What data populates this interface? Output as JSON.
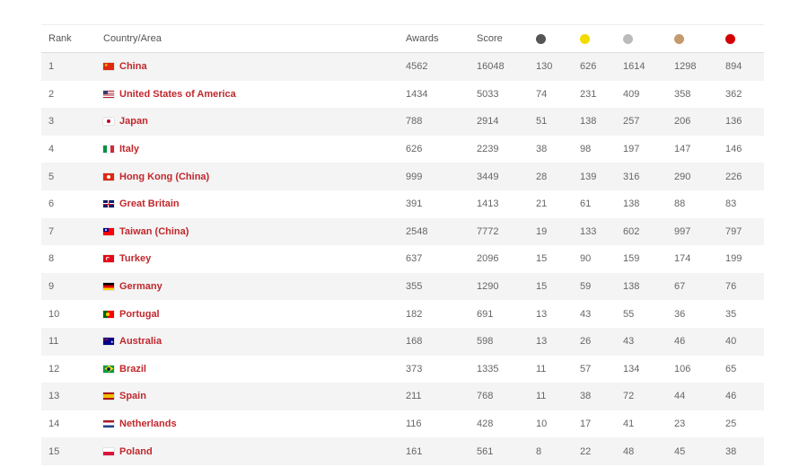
{
  "header": {
    "rank": "Rank",
    "country": "Country/Area",
    "awards": "Awards",
    "score": "Score",
    "medal_colors": [
      "#555555",
      "#f2dc00",
      "#bbbbbb",
      "#c49a6c",
      "#d40000"
    ]
  },
  "rows": [
    {
      "rank": "1",
      "country": "China",
      "flag": "china-flag-icon",
      "awards": "4562",
      "score": "16048",
      "m": [
        "130",
        "626",
        "1614",
        "1298",
        "894"
      ]
    },
    {
      "rank": "2",
      "country": "United States of America",
      "flag": "usa-flag-icon",
      "awards": "1434",
      "score": "5033",
      "m": [
        "74",
        "231",
        "409",
        "358",
        "362"
      ]
    },
    {
      "rank": "3",
      "country": "Japan",
      "flag": "japan-flag-icon",
      "awards": "788",
      "score": "2914",
      "m": [
        "51",
        "138",
        "257",
        "206",
        "136"
      ]
    },
    {
      "rank": "4",
      "country": "Italy",
      "flag": "italy-flag-icon",
      "awards": "626",
      "score": "2239",
      "m": [
        "38",
        "98",
        "197",
        "147",
        "146"
      ]
    },
    {
      "rank": "5",
      "country": "Hong Kong (China)",
      "flag": "hong-kong-flag-icon",
      "awards": "999",
      "score": "3449",
      "m": [
        "28",
        "139",
        "316",
        "290",
        "226"
      ]
    },
    {
      "rank": "6",
      "country": "Great Britain",
      "flag": "great-britain-flag-icon",
      "awards": "391",
      "score": "1413",
      "m": [
        "21",
        "61",
        "138",
        "88",
        "83"
      ]
    },
    {
      "rank": "7",
      "country": "Taiwan (China)",
      "flag": "taiwan-flag-icon",
      "awards": "2548",
      "score": "7772",
      "m": [
        "19",
        "133",
        "602",
        "997",
        "797"
      ]
    },
    {
      "rank": "8",
      "country": "Turkey",
      "flag": "turkey-flag-icon",
      "awards": "637",
      "score": "2096",
      "m": [
        "15",
        "90",
        "159",
        "174",
        "199"
      ]
    },
    {
      "rank": "9",
      "country": "Germany",
      "flag": "germany-flag-icon",
      "awards": "355",
      "score": "1290",
      "m": [
        "15",
        "59",
        "138",
        "67",
        "76"
      ]
    },
    {
      "rank": "10",
      "country": "Portugal",
      "flag": "portugal-flag-icon",
      "awards": "182",
      "score": "691",
      "m": [
        "13",
        "43",
        "55",
        "36",
        "35"
      ]
    },
    {
      "rank": "11",
      "country": "Australia",
      "flag": "australia-flag-icon",
      "awards": "168",
      "score": "598",
      "m": [
        "13",
        "26",
        "43",
        "46",
        "40"
      ]
    },
    {
      "rank": "12",
      "country": "Brazil",
      "flag": "brazil-flag-icon",
      "awards": "373",
      "score": "1335",
      "m": [
        "11",
        "57",
        "134",
        "106",
        "65"
      ]
    },
    {
      "rank": "13",
      "country": "Spain",
      "flag": "spain-flag-icon",
      "awards": "211",
      "score": "768",
      "m": [
        "11",
        "38",
        "72",
        "44",
        "46"
      ]
    },
    {
      "rank": "14",
      "country": "Netherlands",
      "flag": "netherlands-flag-icon",
      "awards": "116",
      "score": "428",
      "m": [
        "10",
        "17",
        "41",
        "23",
        "25"
      ]
    },
    {
      "rank": "15",
      "country": "Poland",
      "flag": "poland-flag-icon",
      "awards": "161",
      "score": "561",
      "m": [
        "8",
        "22",
        "48",
        "45",
        "38"
      ]
    }
  ]
}
